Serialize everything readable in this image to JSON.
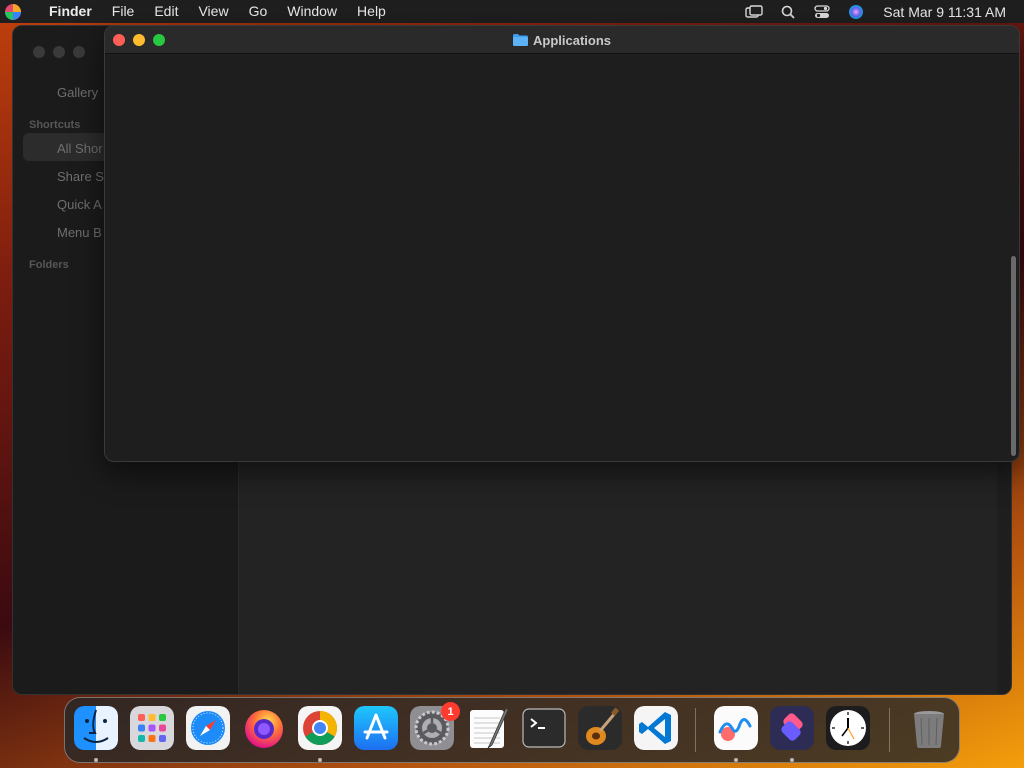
{
  "menubar": {
    "app_name": "Finder",
    "items": [
      "File",
      "Edit",
      "View",
      "Go",
      "Window",
      "Help"
    ],
    "clock": "Sat Mar 9  11:31 AM",
    "status_icons": [
      "screen-mirroring-icon",
      "search-icon",
      "control-center-icon",
      "siri-icon"
    ]
  },
  "shortcuts_window": {
    "sidebar": {
      "gallery": "Gallery",
      "section_shortcuts": "Shortcuts",
      "items": [
        "All Shor",
        "Share S",
        "Quick A",
        "Menu B"
      ],
      "section_folders": "Folders"
    }
  },
  "finder_window": {
    "title": "Applications"
  },
  "dock": {
    "apps": [
      "Finder",
      "Launchpad",
      "Safari",
      "Firefox",
      "Chrome",
      "App Store",
      "System Preferences",
      "TextEdit",
      "Terminal",
      "GarageBand",
      "Visual Studio Code",
      "Freeform",
      "Shortcuts",
      "Clock",
      "Trash"
    ],
    "settings_badge": "1"
  },
  "colors": {
    "close": "#ff5f57",
    "minimize": "#febc2e",
    "maximize": "#28c840",
    "badge": "#ff3b30"
  }
}
